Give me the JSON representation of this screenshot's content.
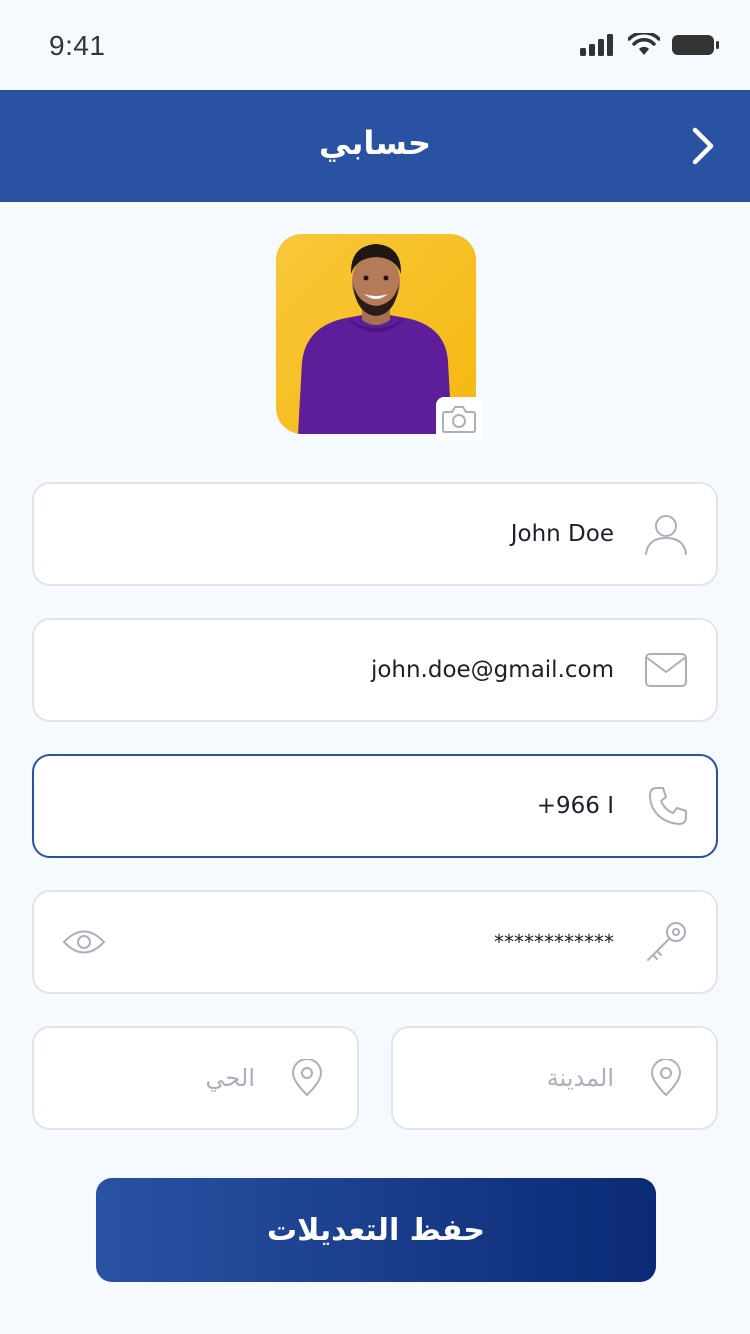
{
  "status_bar": {
    "time": "9:41"
  },
  "header": {
    "title": "حسابي"
  },
  "profile": {
    "photo_alt": "profile photo"
  },
  "form": {
    "name_value": "John Doe",
    "email_value": "john.doe@gmail.com",
    "phone_value": "+966 I",
    "password_value": "************",
    "city_placeholder": "المدينة",
    "district_placeholder": "الحي"
  },
  "actions": {
    "save_label": "حفظ التعديلات"
  },
  "colors": {
    "primary": "#2a52a3",
    "primary_dark": "#0a2a75",
    "background": "#f6f9fe",
    "field_border": "#e1e4ea",
    "icon_gray": "#a9b0bc"
  },
  "icons": {
    "back": "chevron-right-icon",
    "camera": "camera-icon",
    "user": "user-icon",
    "email": "envelope-icon",
    "phone": "phone-icon",
    "password": "key-icon",
    "visibility": "eye-icon",
    "location": "location-pin-icon"
  }
}
